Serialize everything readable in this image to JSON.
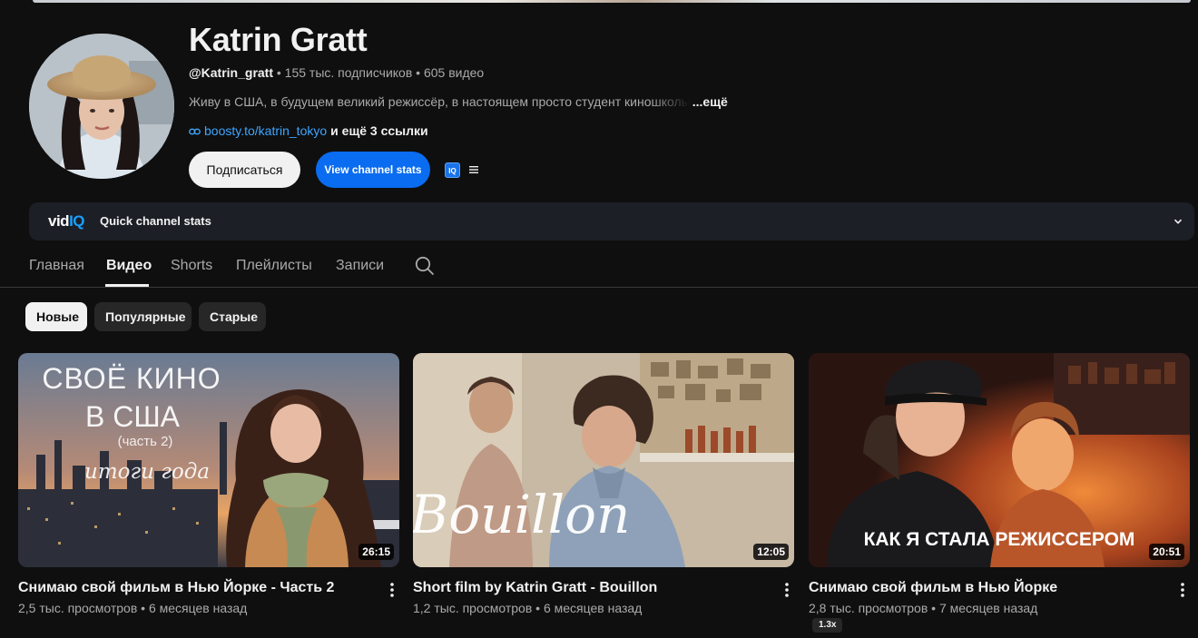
{
  "channel": {
    "name": "Katrin Gratt",
    "handle": "@Katrin_gratt",
    "subscribers": " • 155 тыс. подписчиков",
    "video_count": " • 605 видео",
    "description": "Живу в США, в будущем великий режиссёр, в настоящем просто студент киношколы",
    "more_label": "...ещё",
    "link_text": "boosty.to/katrin_tokyo",
    "extra_links": "и ещё 3 ссылки",
    "subscribe_label": "Подписаться",
    "stats_label": "View channel stats",
    "iq_badge": "IQ"
  },
  "vidiq": {
    "logo_vid": "vid",
    "logo_iq": "IQ",
    "title": "Quick channel stats"
  },
  "tabs": [
    {
      "label": "Главная"
    },
    {
      "label": "Видео"
    },
    {
      "label": "Shorts"
    },
    {
      "label": "Плейлисты"
    },
    {
      "label": "Записи"
    }
  ],
  "chips": [
    {
      "label": "Новые"
    },
    {
      "label": "Популярные"
    },
    {
      "label": "Старые"
    }
  ],
  "videos": [
    {
      "title": "Снимаю свой фильм в Нью Йорке - Часть 2",
      "meta": "2,5 тыс. просмотров • 6 месяцев назад",
      "duration": "26:15",
      "thumb_line1": "СВОЁ КИНО",
      "thumb_line2": "В США",
      "thumb_line3": "(часть 2)",
      "thumb_line4": "итоги года"
    },
    {
      "title": "Short film by Katrin Gratt - Bouillon",
      "meta": "1,2 тыс. просмотров • 6 месяцев назад",
      "duration": "12:05",
      "thumb_text": "Bouillon"
    },
    {
      "title": "Снимаю свой фильм в Нью Йорке",
      "meta": "2,8 тыс. просмотров • 7 месяцев назад",
      "duration": "20:51",
      "thumb_text": "КАК Я СТАЛА РЕЖИССЕРОМ",
      "speed_badge": "1.3x"
    }
  ],
  "colors": {
    "background": "#0f0f0f",
    "accent_blue": "#0a6cf0",
    "link_blue": "#3ea6ff",
    "chip_bg": "#272727"
  }
}
